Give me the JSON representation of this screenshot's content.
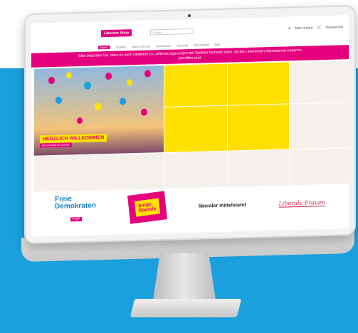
{
  "site": {
    "logo_text": "Liberaler Shop",
    "search_placeholder": "Suchen...",
    "account_label": "Mein Konto",
    "cart_label": "Warenkorb",
    "nav": [
      "Home",
      "Textilien",
      "Büro & Schule",
      "Accessoires",
      "Haushalt",
      "Werbemittel",
      "Sale"
    ],
    "notice": "Bitte beachten Sie, dass es auch weiterhin zu Lieferverzögerungen bei Textilien kommen kann, da die Lieferketten international weiterhin betroffen sind.",
    "welcome": "HERZLICH WILLKOMMEN",
    "welcome_sub": "Merchandise für Liberale",
    "brands": {
      "fdp_line1": "Freie",
      "fdp_line2": "Demokraten",
      "fdp_tag": "FDP",
      "julis_line1": "junge",
      "julis_line2": "liberale",
      "lms": "liberaler mittelstand",
      "lf": "Liberale Frauen"
    }
  },
  "colors": {
    "accent": "#e5007d",
    "yellow": "#ffe000",
    "band": "#1aa0dc"
  }
}
